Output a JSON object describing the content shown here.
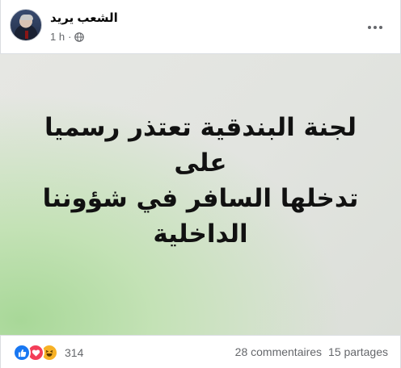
{
  "post": {
    "page_name": "الشعب يريد",
    "time": "1 h",
    "separator": "·",
    "privacy_icon": "globe-icon",
    "more_icon": "more-options-icon",
    "text_line1": "لجنة البندقية تعتذر رسميا على",
    "text_line2": "تدخلها السافر في شؤوننا الداخلية"
  },
  "footer": {
    "reaction_icons": [
      "like-icon",
      "love-icon",
      "haha-icon"
    ],
    "reaction_count": "314",
    "comments": "28 commentaires",
    "shares": "15 partages"
  },
  "colors": {
    "like": "#1877f2",
    "love": "#f33e58",
    "haha": "#f7b125",
    "secondary_text": "#65676b"
  }
}
